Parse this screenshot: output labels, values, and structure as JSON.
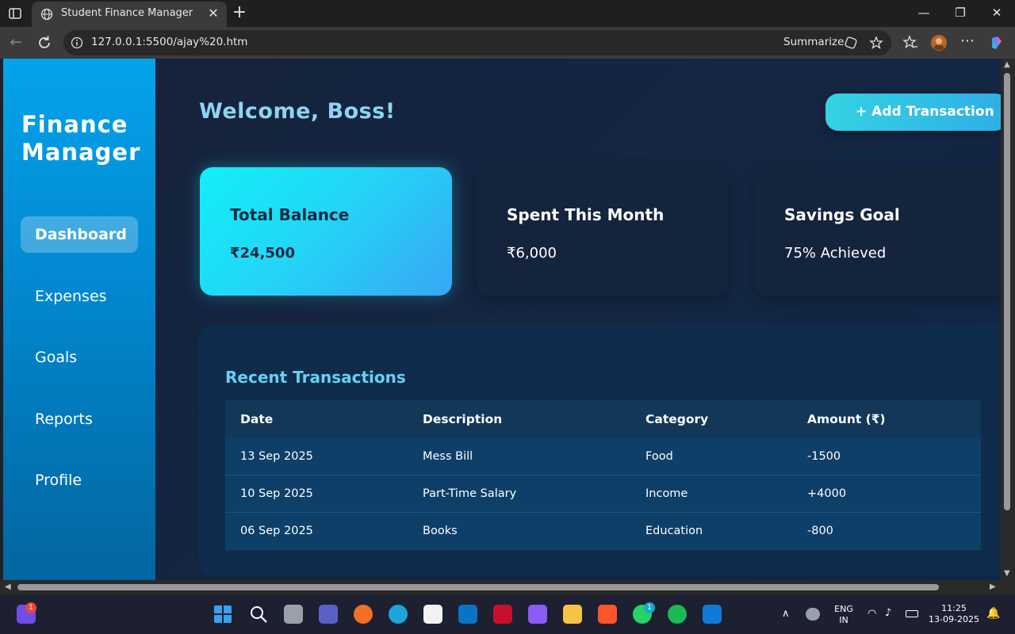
{
  "browser": {
    "tab_title": "Student Finance Manager",
    "tab_close": "✕",
    "new_tab": "+",
    "url": "127.0.0.1:5500/ajay%20.htm",
    "summarize_label": "Summarize",
    "window_controls": {
      "minimize": "—",
      "restore": "❐",
      "close": "✕"
    }
  },
  "sidebar": {
    "brand_line1": "Finance",
    "brand_line2": "Manager",
    "items": [
      {
        "label": "Dashboard",
        "active": true
      },
      {
        "label": "Expenses",
        "active": false
      },
      {
        "label": "Goals",
        "active": false
      },
      {
        "label": "Reports",
        "active": false
      },
      {
        "label": "Profile",
        "active": false
      }
    ]
  },
  "header": {
    "welcome": "Welcome, Boss!",
    "add_button": "+ Add Transaction"
  },
  "cards": [
    {
      "title": "Total Balance",
      "value": "₹24,500"
    },
    {
      "title": "Spent This Month",
      "value": "₹6,000"
    },
    {
      "title": "Savings Goal",
      "value": "75% Achieved"
    }
  ],
  "transactions": {
    "title": "Recent Transactions",
    "headers": [
      "Date",
      "Description",
      "Category",
      "Amount (₹)"
    ],
    "rows": [
      [
        "13 Sep 2025",
        "Mess Bill",
        "Food",
        "-1500"
      ],
      [
        "10 Sep 2025",
        "Part-Time Salary",
        "Income",
        "+4000"
      ],
      [
        "06 Sep 2025",
        "Books",
        "Education",
        "-800"
      ]
    ]
  },
  "taskbar": {
    "meet_badge": "1",
    "whatsapp_badge": "1",
    "lang_line1": "ENG",
    "lang_line2": "IN",
    "time": "11:25",
    "date": "13-09-2025"
  },
  "colors": {
    "sidebar_top": "#04a3ea",
    "sidebar_bottom": "#03669f",
    "accent_cyan": "#12f0f8",
    "welcome_text": "#8fd3f4",
    "panel_title": "#67d0f3"
  }
}
